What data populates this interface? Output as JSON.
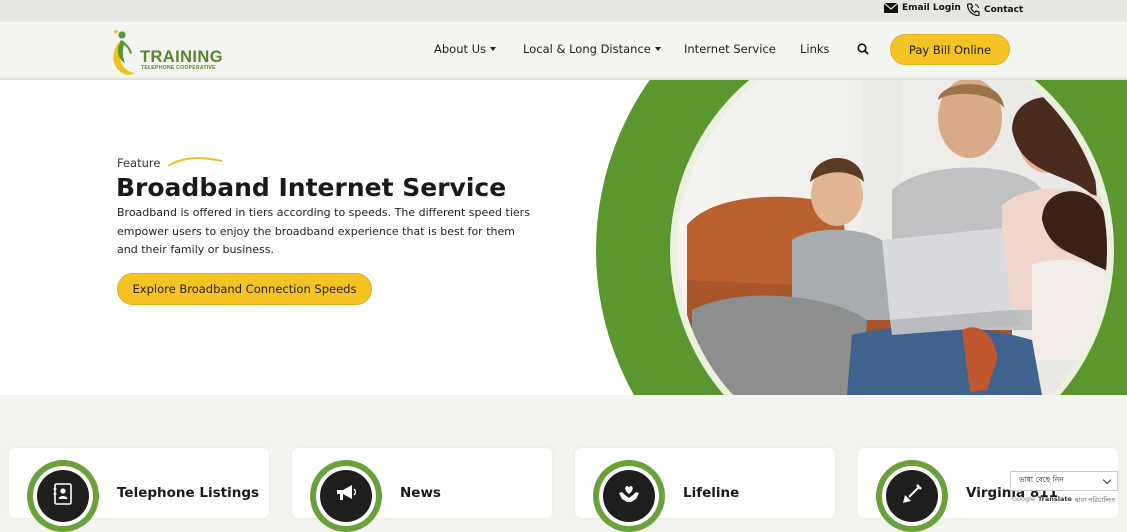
{
  "topbar": {
    "email_login": "Email Login",
    "contact": "Contact"
  },
  "logo": {
    "name": "TRAINING",
    "tagline": "TELEPHONE COOPERATIVE"
  },
  "nav": {
    "items": [
      {
        "label": "About Us",
        "dropdown": true
      },
      {
        "label": "Local & Long Distance",
        "dropdown": true
      },
      {
        "label": "Internet Service",
        "dropdown": false
      },
      {
        "label": "Links",
        "dropdown": false
      }
    ],
    "search_icon": "search-icon",
    "pay_button": "Pay Bill Online"
  },
  "hero": {
    "eyebrow": "Feature",
    "title": "Broadband Internet Service",
    "description": "Broadband is offered in tiers according to speeds. The different speed tiers empower users to enjoy the broadband experience that is best for them and their family or business.",
    "cta": "Explore Broadband Connection Speeds"
  },
  "cards": [
    {
      "title": "Telephone Listings",
      "icon": "contact-book-icon"
    },
    {
      "title": "News",
      "icon": "megaphone-icon"
    },
    {
      "title": "Lifeline",
      "icon": "heart-hands-icon"
    },
    {
      "title": "Virginia 811",
      "icon": "shovel-icon"
    }
  ],
  "google_translate": {
    "select_text": "ভাষা বেছে নিন",
    "powered_google": "Google",
    "powered_translate": "Translate",
    "powered_suffix": "দ্বারা পরিচালিত"
  },
  "colors": {
    "brand_green": "#5b962f",
    "brand_yellow": "#f5c323",
    "icon_dark": "#1e1f1c"
  }
}
